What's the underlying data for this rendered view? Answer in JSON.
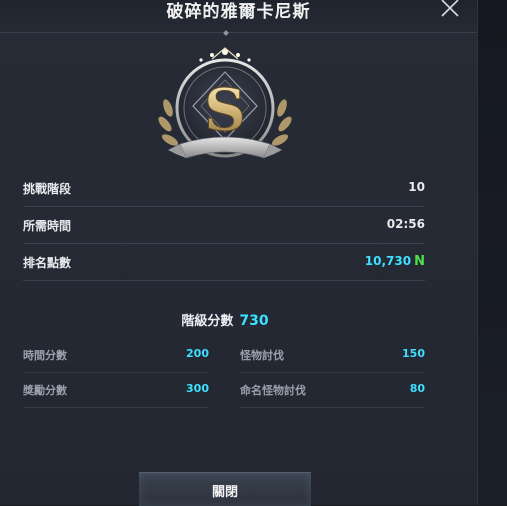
{
  "dialog": {
    "title": "破碎的雅爾卡尼斯",
    "rank_letter": "S"
  },
  "stats": [
    {
      "label": "挑戰階段",
      "value": "10"
    },
    {
      "label": "所需時間",
      "value": "02:56"
    },
    {
      "label": "排名點數",
      "value": "10,730",
      "icon": "N"
    }
  ],
  "grade": {
    "label": "階級分數",
    "value": "730"
  },
  "breakdown": [
    {
      "label": "時間分數",
      "value": "200"
    },
    {
      "label": "怪物討伐",
      "value": "150"
    },
    {
      "label": "獎勵分數",
      "value": "300"
    },
    {
      "label": "命名怪物討伐",
      "value": "80"
    }
  ],
  "footer": {
    "close_label": "關閉"
  },
  "colors": {
    "accent": "#3ee0ff",
    "ranking_icon": "#4fe04f",
    "emblem_gold": "#c9b27a"
  }
}
